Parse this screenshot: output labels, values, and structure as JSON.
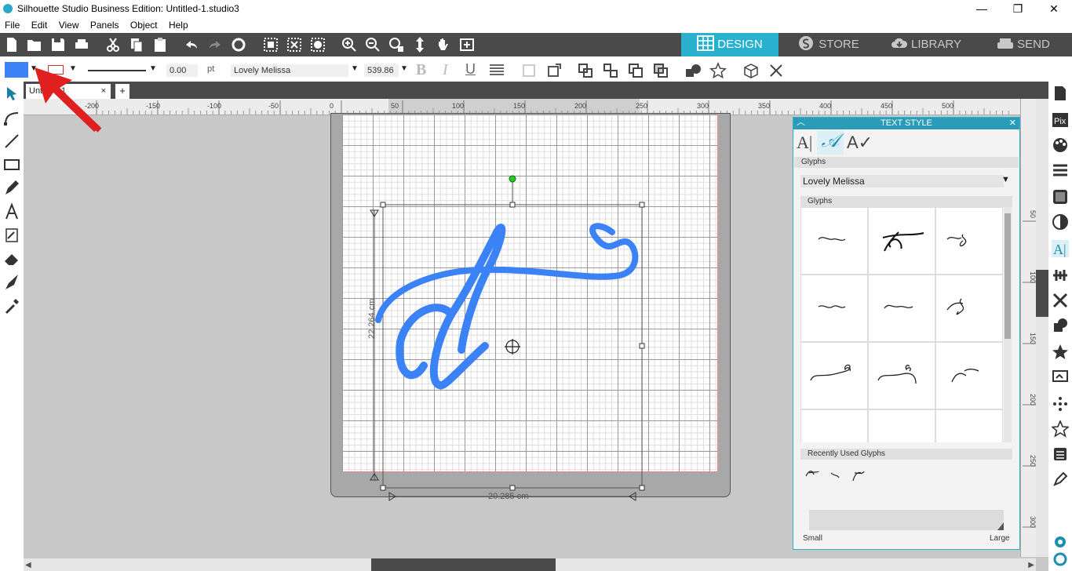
{
  "window": {
    "title": "Silhouette Studio Business Edition: Untitled-1.studio3",
    "minimize": "—",
    "maximize": "❐",
    "close": "✕"
  },
  "menu": [
    "File",
    "Edit",
    "View",
    "Panels",
    "Object",
    "Help"
  ],
  "nav_tabs": [
    {
      "label": "DESIGN",
      "active": true
    },
    {
      "label": "STORE",
      "active": false
    },
    {
      "label": "LIBRARY",
      "active": false
    },
    {
      "label": "SEND",
      "active": false
    }
  ],
  "props": {
    "fill_color": "#3b82f6",
    "line_color": "#d32f2f",
    "line_width": "0.00",
    "line_unit": "pt",
    "font": "Lovely Melissa",
    "font_size": "539.86",
    "bold": "B",
    "italic": "I",
    "underline": "U"
  },
  "doc_tab": {
    "name": "Untitled-1",
    "close": "×",
    "add": "+"
  },
  "hruler_labels": [
    "-200",
    "-150",
    "-100",
    "-50",
    "0",
    "50",
    "100",
    "150",
    "200",
    "250",
    "300",
    "350",
    "400",
    "450",
    "500"
  ],
  "vruler_labels": [
    "50",
    "100",
    "150",
    "200",
    "250",
    "300"
  ],
  "canvas": {
    "height_label": "22.264 cm",
    "width_label": "20.285 cm",
    "selection_color": "#3b82f6"
  },
  "text_style": {
    "title": "TEXT STYLE",
    "section_glyphs": "Glyphs",
    "font_select": "Lovely Melissa",
    "glyphs_header": "Glyphs",
    "recent_header": "Recently Used Glyphs",
    "size_small": "Small",
    "size_large": "Large"
  },
  "colors": {
    "accent": "#2ab0cf",
    "toolbar_bg": "#4a4a4a",
    "arrow": "#e02020"
  }
}
